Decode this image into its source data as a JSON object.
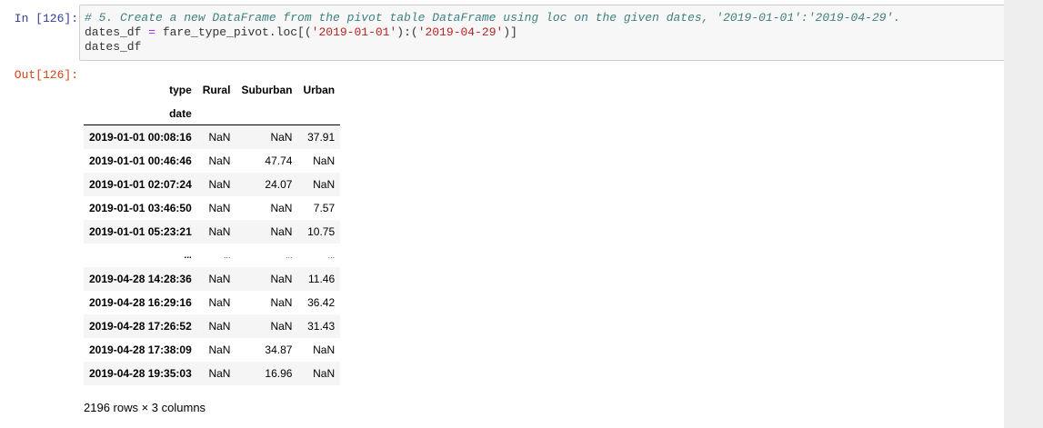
{
  "input_cell": {
    "prompt": "In [126]:",
    "code": {
      "line1_comment": "# 5. Create a new DataFrame from the pivot table DataFrame using loc on the given dates, '2019-01-01':'2019-04-29'.",
      "line2_var": "dates_df ",
      "line2_eq": "=",
      "line2_call_start": " fare_type_pivot.loc[(",
      "line2_str1": "'2019-01-01'",
      "line2_mid": "):(",
      "line2_str2": "'2019-04-29'",
      "line2_end": ")]",
      "line3": "dates_df"
    }
  },
  "output_cell": {
    "prompt": "Out[126]:",
    "table": {
      "columns_name": "type",
      "columns": [
        "Rural",
        "Suburban",
        "Urban"
      ],
      "index_name": "date",
      "rows": [
        {
          "index": "2019-01-01 00:08:16",
          "values": [
            "NaN",
            "NaN",
            "37.91"
          ]
        },
        {
          "index": "2019-01-01 00:46:46",
          "values": [
            "NaN",
            "47.74",
            "NaN"
          ]
        },
        {
          "index": "2019-01-01 02:07:24",
          "values": [
            "NaN",
            "24.07",
            "NaN"
          ]
        },
        {
          "index": "2019-01-01 03:46:50",
          "values": [
            "NaN",
            "NaN",
            "7.57"
          ]
        },
        {
          "index": "2019-01-01 05:23:21",
          "values": [
            "NaN",
            "NaN",
            "10.75"
          ]
        },
        {
          "index": "...",
          "values": [
            "...",
            "...",
            "..."
          ]
        },
        {
          "index": "2019-04-28 14:28:36",
          "values": [
            "NaN",
            "NaN",
            "11.46"
          ]
        },
        {
          "index": "2019-04-28 16:29:16",
          "values": [
            "NaN",
            "NaN",
            "36.42"
          ]
        },
        {
          "index": "2019-04-28 17:26:52",
          "values": [
            "NaN",
            "NaN",
            "31.43"
          ]
        },
        {
          "index": "2019-04-28 17:38:09",
          "values": [
            "NaN",
            "34.87",
            "NaN"
          ]
        },
        {
          "index": "2019-04-28 19:35:03",
          "values": [
            "NaN",
            "16.96",
            "NaN"
          ]
        }
      ]
    },
    "shape_text": "2196 rows × 3 columns"
  },
  "colors": {
    "in_prompt": "#303f9f",
    "out_prompt": "#d84315",
    "comment": "#408080",
    "string": "#ba2121",
    "operator": "#aa22ff"
  }
}
